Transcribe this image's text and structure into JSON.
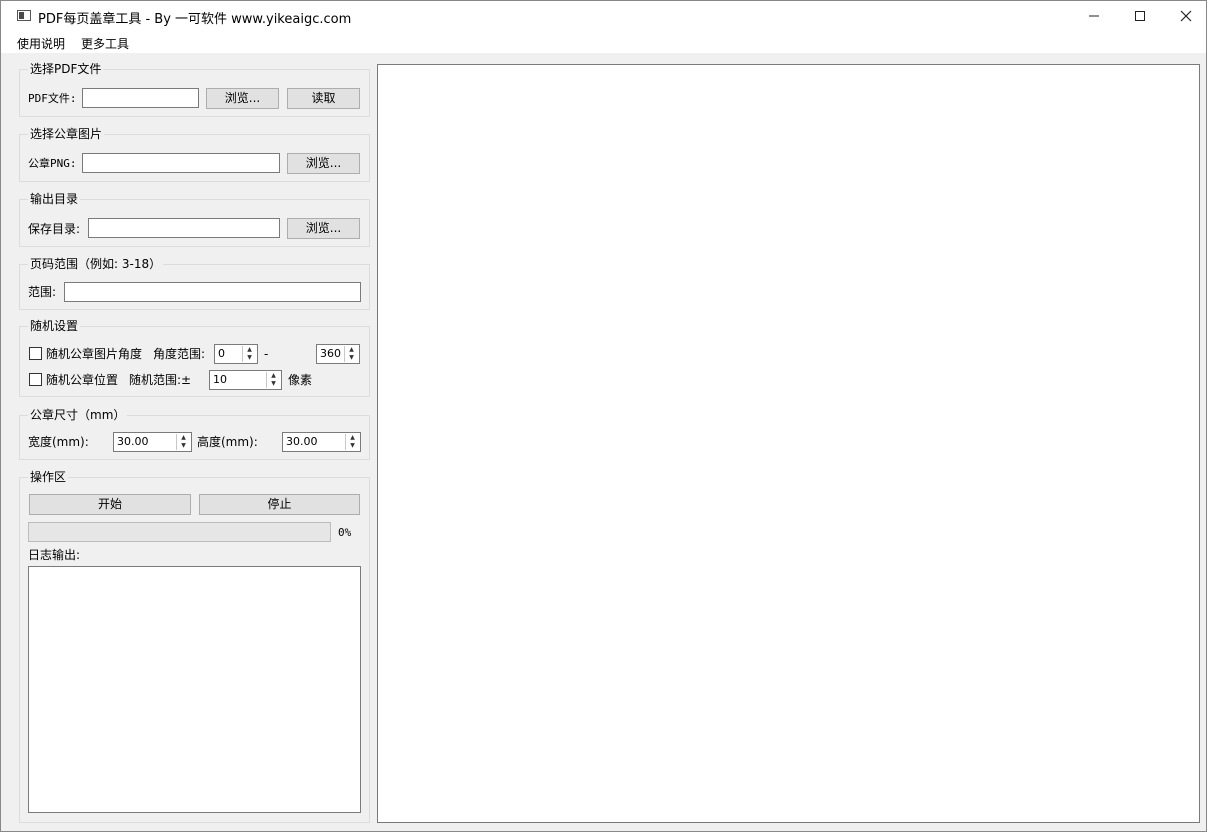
{
  "window": {
    "title": "PDF每页盖章工具 - By 一可软件 www.yikeaigc.com",
    "min_icon": "minimize-icon",
    "max_icon": "maximize-icon",
    "close_icon": "close-icon"
  },
  "menu": {
    "items": [
      "使用说明",
      "更多工具"
    ]
  },
  "pdf_group": {
    "title": "选择PDF文件",
    "label": "PDF文件:",
    "value": "",
    "browse_label": "浏览...",
    "read_label": "读取"
  },
  "stamp_group": {
    "title": "选择公章图片",
    "label": "公章PNG:",
    "value": "",
    "browse_label": "浏览..."
  },
  "output_group": {
    "title": "输出目录",
    "label": "保存目录:",
    "value": "",
    "browse_label": "浏览..."
  },
  "range_group": {
    "title": "页码范围（例如: 3-18）",
    "label": "范围:",
    "value": ""
  },
  "random_group": {
    "title": "随机设置",
    "angle_checkbox_label": "随机公章图片角度",
    "angle_checked": false,
    "angle_range_label": "角度范围:",
    "angle_min": "0",
    "dash": "-",
    "angle_max": "360",
    "pos_checkbox_label": "随机公章位置",
    "pos_checked": false,
    "pos_range_label": "随机范围:±",
    "pos_range": "10",
    "pos_unit": "像素"
  },
  "size_group": {
    "title": "公章尺寸（mm）",
    "width_label": "宽度(mm):",
    "width_value": "30.00",
    "height_label": "高度(mm):",
    "height_value": "30.00"
  },
  "ops_group": {
    "title": "操作区",
    "start_label": "开始",
    "stop_label": "停止",
    "progress": 0,
    "progress_text": "0%",
    "log_label": "日志输出:",
    "log_text": ""
  },
  "colors": {
    "window_bg": "#f0f0f0",
    "button_bg": "#e1e1e1",
    "input_border": "#7a7a7a"
  }
}
